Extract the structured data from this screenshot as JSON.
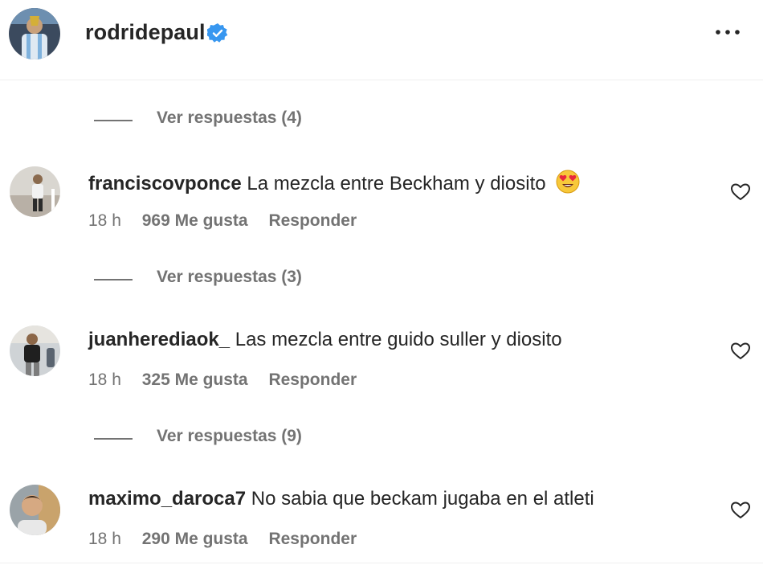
{
  "header": {
    "username": "rodridepaul",
    "verified_icon": "verified-badge-icon",
    "more_icon": "more-options-icon",
    "accent": "#3897f0"
  },
  "threads": [
    {
      "replies_label": "Ver respuestas (4)"
    },
    {
      "replies_label": "Ver respuestas (3)"
    },
    {
      "replies_label": "Ver respuestas (9)"
    }
  ],
  "comments": [
    {
      "username": "franciscovponce",
      "text": "La mezcla entre Beckham y diosito",
      "emoji": "heart-eyes-emoji",
      "time": "18 h",
      "likes": "969 Me gusta",
      "reply": "Responder"
    },
    {
      "username": "juanherediaok_",
      "text": "Las mezcla entre guido suller y diosito",
      "time": "18 h",
      "likes": "325 Me gusta",
      "reply": "Responder"
    },
    {
      "username": "maximo_daroca7",
      "text": "No sabia que beckam jugaba en el atleti",
      "time": "18 h",
      "likes": "290 Me gusta",
      "reply": "Responder"
    }
  ]
}
